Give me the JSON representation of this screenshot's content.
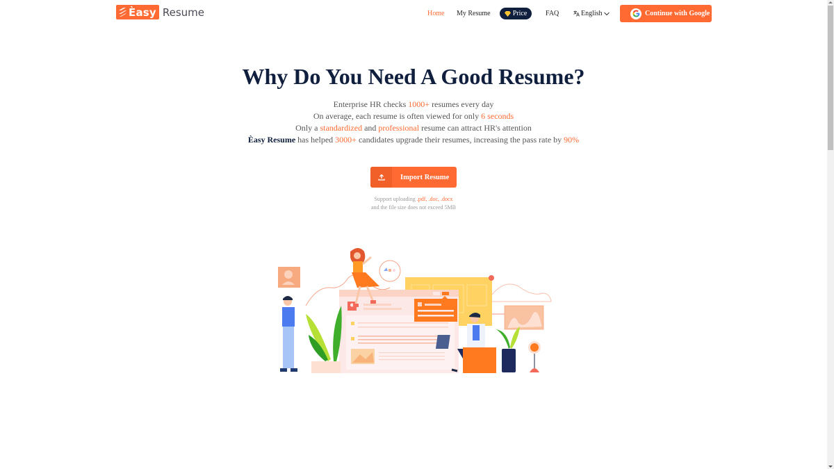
{
  "header": {
    "logo": {
      "badge_text": "Èasy",
      "word": "Resume",
      "icon": "lightning-stripes-icon"
    },
    "nav": {
      "home": "Home",
      "my_resume": "My Resume",
      "price": "Price",
      "price_icon": "diamond-icon",
      "faq": "FAQ",
      "language": "English",
      "language_icon": "translate-icon"
    },
    "google_button": "Continue with Google"
  },
  "hero": {
    "title": "Why Do You Need A Good Resume?",
    "line1": {
      "pre": "Enterprise HR checks ",
      "hl": "1000+",
      "post": " resumes every day"
    },
    "line2": {
      "pre": "On average, each resume is often viewed for only ",
      "hl": "6 seconds"
    },
    "line3": {
      "pre": "Only a ",
      "hl1": "standardized",
      "mid": " and ",
      "hl2": "professional",
      "post": " resume can attract HR's attention"
    },
    "line4": {
      "brand": "Èasy Resume",
      "pre": " has helped ",
      "hl1": "3000+",
      "mid": " candidates upgrade their resumes, increasing the pass rate by ",
      "hl2": "90%"
    }
  },
  "import": {
    "label": "Import Resume",
    "icon": "upload-icon",
    "support_pre": "Support uploading ",
    "support_formats": ".pdf, .doc, .docx",
    "support_line2": "and the file size does not exceed 5MB"
  },
  "colors": {
    "accent": "#ff6a33",
    "navy": "#0f1f3d",
    "text_gray": "#555555"
  }
}
